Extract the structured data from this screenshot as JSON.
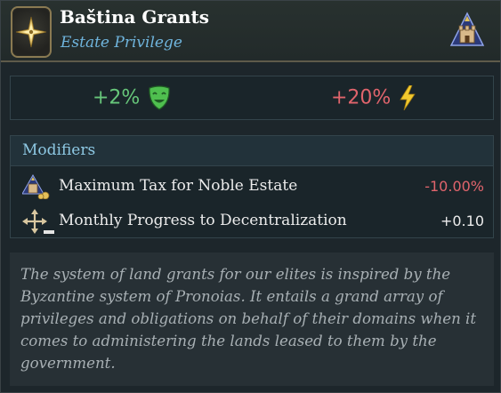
{
  "header": {
    "title": "Baština Grants",
    "subtitle": "Estate Privilege",
    "privilege_icon": "compass-star-icon",
    "estate_icon": "noble-estate-castle-icon"
  },
  "effects": [
    {
      "value": "+2%",
      "icon": "happy-mask-icon",
      "color": "#67c67a"
    },
    {
      "value": "+20%",
      "icon": "lightning-icon",
      "color": "#e0646c"
    }
  ],
  "modifiers": {
    "title": "Modifiers",
    "items": [
      {
        "label": "Maximum Tax for Noble Estate",
        "value": "-10.00%",
        "icon": "noble-estate-tax-icon",
        "color": "#e0646c"
      },
      {
        "label": "Monthly Progress to Decentralization",
        "value": "+0.10",
        "icon": "decentralization-arrows-icon",
        "color": "#ececec"
      }
    ]
  },
  "description": "The system of land grants for our elites is inspired by the Byzantine system of Pronoias. It entails a grand array of privileges and obligations on behalf of their domains when it comes to administering the lands leased to them by the government."
}
